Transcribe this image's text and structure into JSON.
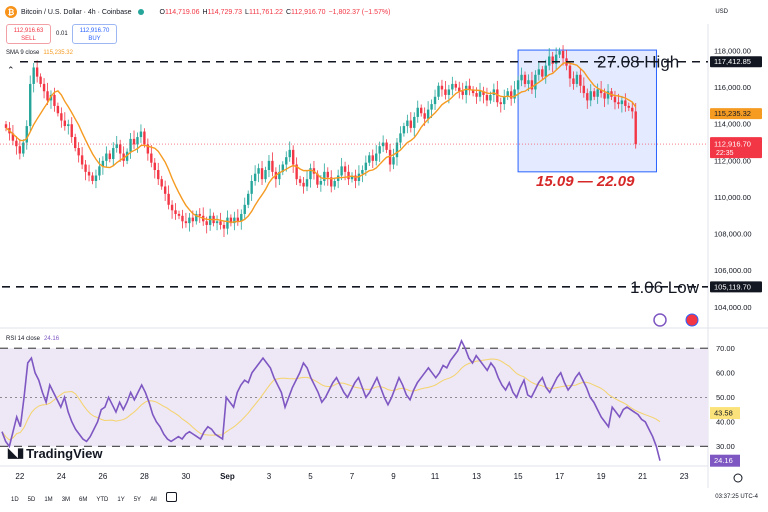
{
  "header": {
    "symbol_icon": "bitcoin-icon",
    "title": "Bitcoin / U.S. Dollar · 4h · Coinbase",
    "ohlc": [
      {
        "k": "O",
        "v": "114,719.06"
      },
      {
        "k": "H",
        "v": "114,729.73"
      },
      {
        "k": "L",
        "v": "111,761.22"
      },
      {
        "k": "C",
        "v": "112,916.70"
      }
    ],
    "change": "−1,802.37 (−1.57%)",
    "currency": "USD"
  },
  "trade": {
    "sell_price": "112,916.63",
    "sell_label": "SELL",
    "spread": "0.01",
    "buy_price": "112,916.70",
    "buy_label": "BUY"
  },
  "sma": {
    "label": "SMA 9 close",
    "value": "115,235.32"
  },
  "rsi": {
    "label": "RSI 14 close",
    "value": "24.16",
    "ma_value": "43.58"
  },
  "annotations": {
    "high_text": "27.08  High",
    "low_text": "1.06 Low",
    "range_text": "15.09 — 22.09"
  },
  "chart_data": [
    {
      "type": "candlestick",
      "title": "",
      "y_ticks": [
        104000,
        106000,
        108000,
        110000,
        112000,
        114000,
        116000,
        118000
      ],
      "y_tick_labels": [
        "104,000.00",
        "106,000.00",
        "108,000.00",
        "110,000.00",
        "112,000.00",
        "114,000.00",
        "116,000.00",
        "118,000.00"
      ],
      "ylim": [
        103200,
        118600
      ],
      "x_ticks": [
        {
          "label": "22",
          "bar": 4
        },
        {
          "label": "24",
          "bar": 16
        },
        {
          "label": "26",
          "bar": 28
        },
        {
          "label": "28",
          "bar": 40
        },
        {
          "label": "30",
          "bar": 52
        },
        {
          "label": "Sep",
          "bar": 64
        },
        {
          "label": "3",
          "bar": 76
        },
        {
          "label": "5",
          "bar": 88
        },
        {
          "label": "7",
          "bar": 100
        },
        {
          "label": "9",
          "bar": 112
        },
        {
          "label": "11",
          "bar": 124
        },
        {
          "label": "13",
          "bar": 136
        },
        {
          "label": "15",
          "bar": 148
        },
        {
          "label": "17",
          "bar": 160
        },
        {
          "label": "19",
          "bar": 172
        },
        {
          "label": "21",
          "bar": 184
        },
        {
          "label": "23",
          "bar": 196
        }
      ],
      "closes": [
        113800,
        113500,
        113100,
        112800,
        112400,
        113000,
        113900,
        116200,
        117100,
        116600,
        116200,
        115800,
        115300,
        115600,
        115000,
        114600,
        114200,
        113900,
        114000,
        113300,
        112700,
        112300,
        111800,
        111400,
        111200,
        110900,
        111200,
        111700,
        112000,
        112400,
        112100,
        112700,
        112900,
        112400,
        112000,
        112500,
        113200,
        112900,
        113300,
        113600,
        112900,
        112400,
        111900,
        111500,
        111000,
        110600,
        110200,
        109600,
        109300,
        109100,
        109000,
        108700,
        108600,
        108900,
        108700,
        109100,
        109000,
        108700,
        108500,
        109000,
        108600,
        108700,
        108500,
        108300,
        108900,
        108600,
        108900,
        108700,
        109100,
        109600,
        110200,
        110900,
        111300,
        111600,
        111000,
        111500,
        112000,
        111400,
        111000,
        111400,
        111800,
        112200,
        112600,
        111800,
        111000,
        110800,
        110600,
        111000,
        111600,
        111300,
        110700,
        110900,
        111400,
        111100,
        110600,
        110900,
        111200,
        111700,
        111400,
        111000,
        111200,
        110900,
        111300,
        111500,
        111900,
        112300,
        112000,
        112400,
        112800,
        113000,
        112600,
        111800,
        112200,
        113000,
        113500,
        113900,
        114200,
        113800,
        114400,
        114900,
        114600,
        114300,
        114800,
        115100,
        115500,
        116100,
        115900,
        115600,
        115900,
        116200,
        116000,
        115800,
        115600,
        116100,
        115900,
        115700,
        115500,
        115800,
        115600,
        115300,
        115600,
        115900,
        115200,
        115100,
        115500,
        115800,
        115400,
        115900,
        116400,
        116700,
        116200,
        116400,
        115900,
        116700,
        117000,
        116600,
        117200,
        117700,
        117300,
        117800,
        118000,
        117600,
        117200,
        116500,
        116200,
        116700,
        116100,
        115700,
        115300,
        115800,
        115500,
        115900,
        115700,
        115400,
        115800,
        115500,
        115200,
        115100,
        115300,
        115000,
        114900,
        114700,
        112917
      ],
      "sma_values": "computed as 9-period moving average of closes (orange line)",
      "last_price_label": "112,916.70",
      "countdown": "22:35",
      "high_line_label": "117,412.85",
      "low_line_label": "105,119.70",
      "sma_label": "115,235.32",
      "high_level": 117412.85,
      "low_level": 105119.7,
      "range_box": {
        "x_start_bar": 148,
        "x_end_bar": 188,
        "y_top": 118050,
        "y_bottom": 111400
      },
      "colors": {
        "up": "#26a69a",
        "down": "#f23645",
        "sma": "#f59b22",
        "box_fill": "#dbe3ff",
        "box_stroke": "#2962ff",
        "annotation_red": "#d62828"
      }
    },
    {
      "type": "line",
      "title": "RSI 14 close",
      "y_ticks": [
        30,
        40,
        50,
        60,
        70
      ],
      "y_tick_labels": [
        "30.00",
        "40.00",
        "50.00",
        "60.00",
        "70.00"
      ],
      "ylim": [
        22,
        75
      ],
      "band": [
        30,
        70
      ],
      "rsi_values": [
        36,
        32,
        30,
        36,
        42,
        38,
        50,
        64,
        66,
        60,
        57,
        52,
        48,
        55,
        52,
        49,
        46,
        50,
        44,
        40,
        37,
        35,
        33,
        32,
        34,
        37,
        40,
        45,
        46,
        50,
        47,
        44,
        48,
        45,
        48,
        52,
        49,
        52,
        55,
        52,
        48,
        43,
        40,
        38,
        35,
        33,
        32,
        33,
        34,
        33,
        35,
        36,
        35,
        34,
        33,
        36,
        38,
        37,
        35,
        34,
        33,
        50,
        48,
        46,
        52,
        55,
        57,
        56,
        60,
        62,
        64,
        66,
        64,
        62,
        58,
        55,
        52,
        46,
        50,
        54,
        57,
        60,
        64,
        62,
        58,
        55,
        52,
        48,
        50,
        53,
        56,
        58,
        55,
        52,
        50,
        53,
        56,
        58,
        54,
        50,
        52,
        55,
        58,
        54,
        50,
        47,
        50,
        54,
        58,
        55,
        51,
        49,
        53,
        56,
        58,
        60,
        62,
        60,
        58,
        60,
        63,
        62,
        65,
        67,
        69,
        73,
        70,
        66,
        64,
        67,
        65,
        63,
        61,
        64,
        62,
        58,
        55,
        53,
        56,
        52,
        50,
        54,
        57,
        51,
        50,
        53,
        56,
        58,
        54,
        52,
        55,
        58,
        60,
        56,
        53,
        55,
        58,
        60,
        57,
        54,
        50,
        48,
        45,
        42,
        40,
        38,
        46,
        44,
        42,
        45,
        46,
        45,
        44,
        43,
        41,
        40,
        37,
        34,
        30,
        24.16
      ],
      "rsi_ma_values": "computed as moving average of RSI (yellow line)",
      "rsi_label": "24.16",
      "rsi_ma_label": "43.58",
      "colors": {
        "rsi": "#7e57c2",
        "rsi_ma": "#f5d36b",
        "band": "#ede7f6"
      }
    }
  ],
  "bottom": {
    "timeframes": [
      "1D",
      "5D",
      "1M",
      "3M",
      "6M",
      "YTD",
      "1Y",
      "5Y",
      "All"
    ],
    "clock": "03:37:25 UTC-4",
    "calendar_icon": "calendar-icon"
  },
  "logo": {
    "text": "TradingView",
    "icon": "tradingview-logo-icon"
  },
  "icons": [
    "compare-icon",
    "flag-us-icon",
    "settings-icon"
  ]
}
